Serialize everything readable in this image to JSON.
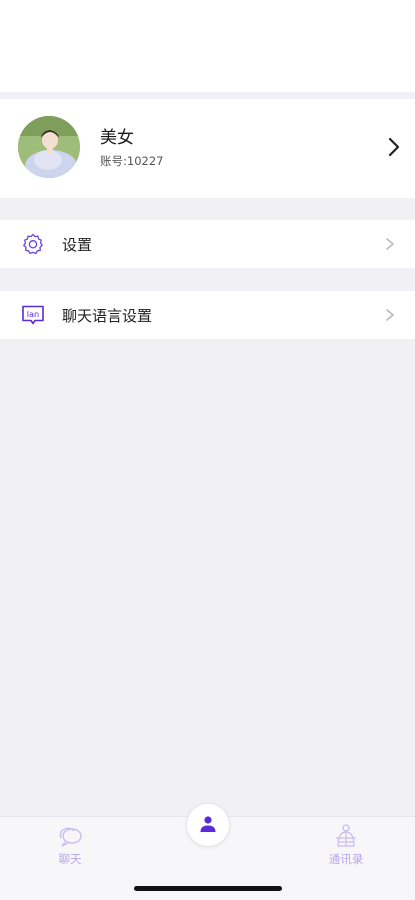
{
  "profile": {
    "name": "美女",
    "account": "账号:10227"
  },
  "menu": {
    "items": [
      {
        "label": "设置",
        "icon": "gear-icon"
      },
      {
        "label": "聊天语言设置",
        "icon": "language-icon",
        "icon_text": "lan"
      }
    ]
  },
  "tabbar": {
    "chat_label": "聊天",
    "contacts_label": "通讯录",
    "active": "me"
  },
  "colors": {
    "accent": "#5a2bd6",
    "accent_light": "#b8a6e6",
    "background": "#f0f0f5",
    "card": "#ffffff"
  }
}
